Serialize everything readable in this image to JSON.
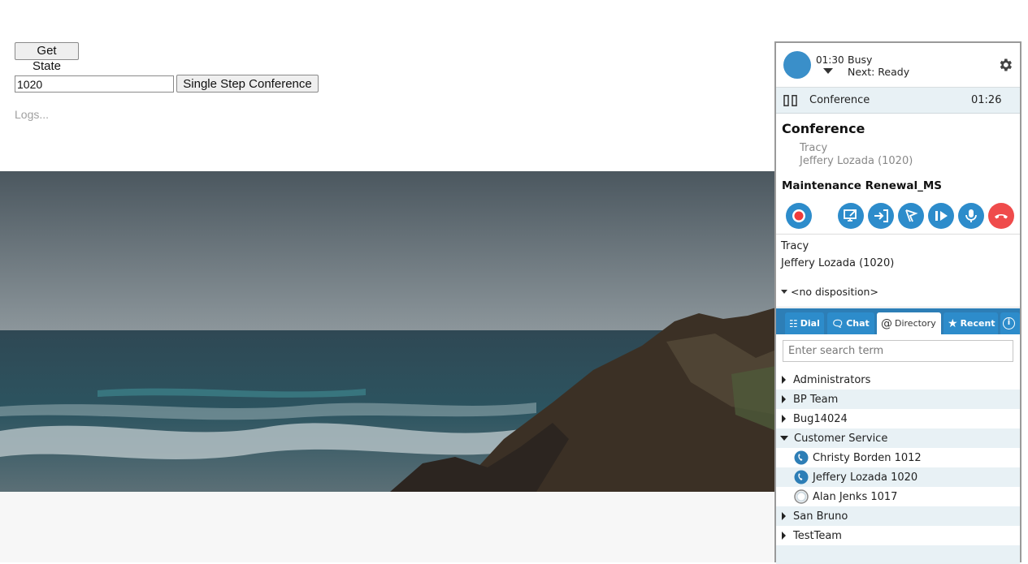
{
  "page": {
    "get_state_label": "Get State",
    "number_value": "1020",
    "single_step_label": "Single Step Conference",
    "logs_placeholder": "Logs..."
  },
  "panel": {
    "status": {
      "timer": "01:30",
      "state": "Busy",
      "next": "Next: Ready",
      "avatar_color": "#3a8fc9"
    },
    "call": {
      "type": "Conference",
      "timer": "01:26"
    },
    "conference": {
      "title": "Conference",
      "parties": [
        "Tracy",
        "Jeffery Lozada (1020)"
      ]
    },
    "campaign": "Maintenance Renewal_MS",
    "actions": [
      {
        "name": "record",
        "icon": "record-icon"
      },
      {
        "name": "screen-pop",
        "icon": "external-screen-icon"
      },
      {
        "name": "transfer",
        "icon": "transfer-icon"
      },
      {
        "name": "flag",
        "icon": "flag-icon"
      },
      {
        "name": "resume",
        "icon": "play-icon"
      },
      {
        "name": "mute",
        "icon": "microphone-icon"
      },
      {
        "name": "hangup",
        "icon": "hangup-icon"
      }
    ],
    "parties": [
      "Tracy",
      "Jeffery Lozada (1020)"
    ],
    "disposition": "<no disposition>",
    "tabs": {
      "dial": "Dial",
      "chat": "Chat",
      "directory": "Directory",
      "recent": "Recent"
    },
    "search_placeholder": "Enter search term",
    "directory": {
      "groups": [
        {
          "label": "Administrators",
          "expanded": false
        },
        {
          "label": "BP Team",
          "expanded": false
        },
        {
          "label": "Bug14024",
          "expanded": false
        },
        {
          "label": "Customer Service",
          "expanded": true,
          "members": [
            {
              "label": "Christy Borden 1012",
              "status": "on-call"
            },
            {
              "label": "Jeffery Lozada 1020",
              "status": "on-call"
            },
            {
              "label": "Alan Jenks 1017",
              "status": "available"
            }
          ]
        },
        {
          "label": "San Bruno",
          "expanded": false
        },
        {
          "label": "TestTeam",
          "expanded": false
        }
      ]
    },
    "colors": {
      "accent": "#2d8ccb",
      "hangup": "#ef4b4b",
      "row_alt": "#e8f1f5"
    }
  }
}
